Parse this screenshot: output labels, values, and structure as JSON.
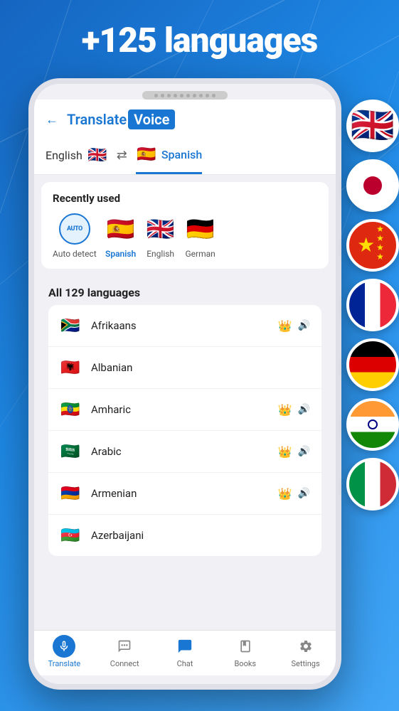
{
  "hero": {
    "title": "+125 languages"
  },
  "app": {
    "header": {
      "back_icon": "←",
      "name_translate": "Translate",
      "name_voice": "Voice"
    },
    "lang_switcher": {
      "source_lang": "English",
      "target_lang": "Spanish",
      "swap_icon": "⇄"
    },
    "recently_used": {
      "title": "Recently used",
      "items": [
        {
          "label": "Auto detect",
          "type": "auto"
        },
        {
          "label": "Spanish",
          "type": "flag",
          "flag": "🇪🇸",
          "highlight": true
        },
        {
          "label": "English",
          "type": "flag",
          "flag": "🇬🇧"
        },
        {
          "label": "German",
          "type": "flag",
          "flag": "🇩🇪"
        }
      ]
    },
    "all_languages": {
      "title": "All 129 languages",
      "languages": [
        {
          "name": "Afrikaans",
          "flag": "🇿🇦",
          "has_crown": true,
          "has_voice": true
        },
        {
          "name": "Albanian",
          "flag": "🇦🇱",
          "has_crown": false,
          "has_voice": false
        },
        {
          "name": "Amharic",
          "flag": "🇪🇹",
          "has_crown": true,
          "has_voice": true
        },
        {
          "name": "Arabic",
          "flag": "🇸🇦",
          "has_crown": true,
          "has_voice": true
        },
        {
          "name": "Armenian",
          "flag": "🇦🇲",
          "has_crown": true,
          "has_voice": true
        },
        {
          "name": "Azerbaijani",
          "flag": "🇦🇿",
          "has_crown": false,
          "has_voice": false
        }
      ]
    },
    "bottom_nav": [
      {
        "id": "translate",
        "label": "Translate",
        "icon": "🎤",
        "active": true
      },
      {
        "id": "connect",
        "label": "Connect",
        "icon": "🗣️",
        "active": false
      },
      {
        "id": "chat",
        "label": "Chat",
        "icon": "💬",
        "active": false
      },
      {
        "id": "books",
        "label": "Books",
        "icon": "📖",
        "active": false
      },
      {
        "id": "settings",
        "label": "Settings",
        "icon": "⚙️",
        "active": false
      }
    ]
  },
  "floating_flags": [
    {
      "country": "UK",
      "emoji": "🇬🇧"
    },
    {
      "country": "Japan",
      "emoji": "🇯🇵"
    },
    {
      "country": "China",
      "emoji": "🇨🇳"
    },
    {
      "country": "France",
      "emoji": "🇫🇷"
    },
    {
      "country": "Germany",
      "emoji": "🇩🇪"
    },
    {
      "country": "India",
      "emoji": "🇮🇳"
    },
    {
      "country": "Italy",
      "emoji": "🇮🇹"
    }
  ],
  "icons": {
    "crown": "👑",
    "voice": "🔊",
    "mic": "🎤",
    "book": "📖",
    "gear": "⚙️",
    "chat": "💬",
    "speak": "🗣️"
  }
}
